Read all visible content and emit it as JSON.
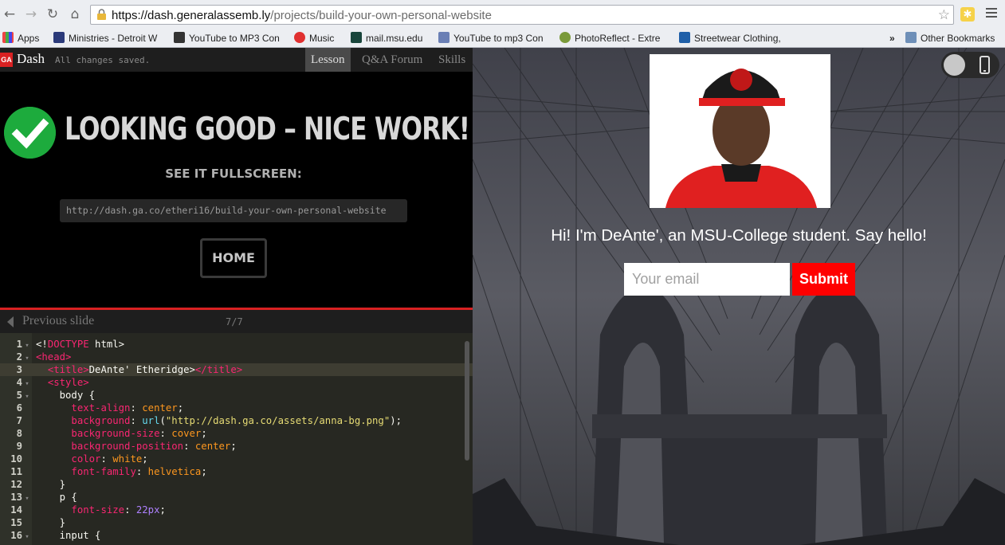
{
  "browser": {
    "url_host": "https://dash.generalassemb.ly",
    "url_path": "/projects/build-your-own-personal-website",
    "nav_icons": [
      "back-icon",
      "forward-icon",
      "reload-icon",
      "home-icon"
    ],
    "bookmarks": [
      {
        "label": "Apps",
        "icon": "apps-grid-icon"
      },
      {
        "label": "Ministries - Detroit W",
        "icon": "ministries-icon"
      },
      {
        "label": "YouTube to MP3 Con",
        "icon": "youtube-mp3-icon"
      },
      {
        "label": "Music",
        "icon": "music-icon"
      },
      {
        "label": "mail.msu.edu",
        "icon": "msu-icon"
      },
      {
        "label": "YouTube to mp3 Con",
        "icon": "youtube-mp3-icon"
      },
      {
        "label": "PhotoReflect - Extre",
        "icon": "photoreflect-icon"
      },
      {
        "label": "Streetwear Clothing,",
        "icon": "streetwear-icon"
      }
    ],
    "overflow": "»",
    "other_bookmarks": "Other Bookmarks"
  },
  "dash": {
    "logo": "GA",
    "title": "Dash",
    "save_status": "All changes saved.",
    "tabs": [
      "Lesson",
      "Q&A Forum",
      "Skills"
    ],
    "active_tab": "Lesson",
    "headline": "LOOKING GOOD – NICE WORK!",
    "fullscreen_label": "SEE IT FULLSCREEN:",
    "fullscreen_url": "http://dash.ga.co/etheri16/build-your-own-personal-website",
    "home_button": "HOME",
    "previous_slide": "Previous slide",
    "slide_counter": "7/7"
  },
  "editor": {
    "active_line": 3,
    "lines": [
      {
        "n": "1",
        "fold": "▾",
        "html": "&lt;!<span class='dt'>DOCTYPE</span> html&gt;"
      },
      {
        "n": "2",
        "fold": "▾",
        "html": "<span class='tg'>&lt;head&gt;</span>"
      },
      {
        "n": "3",
        "fold": "",
        "html": "  <span class='tg'>&lt;title&gt;</span>DeAnte' Etheridge&gt;<span class='tg'>&lt;/title&gt;</span>"
      },
      {
        "n": "4",
        "fold": "▾",
        "html": "  <span class='tg'>&lt;style&gt;</span>"
      },
      {
        "n": "5",
        "fold": "▾",
        "html": "    body {"
      },
      {
        "n": "6",
        "fold": "",
        "html": "      <span class='at'>text-align</span>: <span class='vl'>center</span>;"
      },
      {
        "n": "7",
        "fold": "",
        "html": "      <span class='at'>background</span>: <span class='fn'>url</span>(<span class='st'>\"http://dash.ga.co/assets/anna-bg.png\"</span>);"
      },
      {
        "n": "8",
        "fold": "",
        "html": "      <span class='at'>background-size</span>: <span class='vl'>cover</span>;"
      },
      {
        "n": "9",
        "fold": "",
        "html": "      <span class='at'>background-position</span>: <span class='vl'>center</span>;"
      },
      {
        "n": "10",
        "fold": "",
        "html": "      <span class='at'>color</span>: <span class='vl'>white</span>;"
      },
      {
        "n": "11",
        "fold": "",
        "html": "      <span class='at'>font-family</span>: <span class='vl'>helvetica</span>;"
      },
      {
        "n": "12",
        "fold": "",
        "html": "    }"
      },
      {
        "n": "13",
        "fold": "▾",
        "html": "    p {"
      },
      {
        "n": "14",
        "fold": "",
        "html": "      <span class='at'>font-size</span>: <span class='nm'>22px</span>;"
      },
      {
        "n": "15",
        "fold": "",
        "html": "    }"
      },
      {
        "n": "16",
        "fold": "▾",
        "html": "    input {"
      }
    ]
  },
  "preview": {
    "greeting": "Hi! I'm DeAnte', an MSU-College student. Say hello!",
    "email_placeholder": "Your email",
    "submit_label": "Submit"
  }
}
